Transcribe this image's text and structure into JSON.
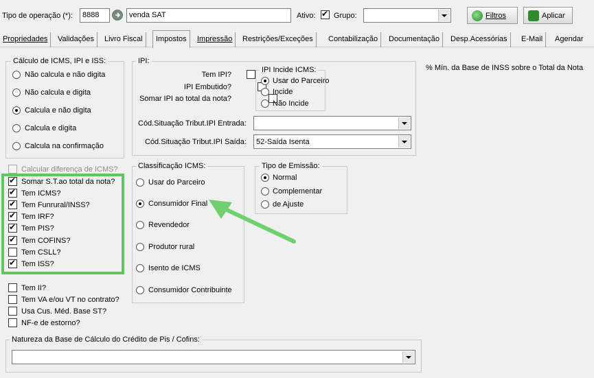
{
  "header": {
    "tipo_label": "Tipo de operação (*):",
    "tipo_code": "8888",
    "tipo_name": "venda SAT",
    "ativo_label": "Ativo:",
    "grupo_label": "Grupo:",
    "grupo_value": "",
    "filtros_label": "Filtros",
    "aplicar_label": "Aplicar"
  },
  "tabs": [
    {
      "label": "Propriedades"
    },
    {
      "label": "Validações"
    },
    {
      "label": "Livro Fiscal"
    },
    {
      "label": "Impostos"
    },
    {
      "label": "Impressão"
    },
    {
      "label": "Restrições/Exceções"
    },
    {
      "label": "Contabilização"
    },
    {
      "label": "Documentação"
    },
    {
      "label": "Desp.Acessórias"
    },
    {
      "label": "E-Mail"
    },
    {
      "label": "Agendar"
    }
  ],
  "calculo": {
    "title": "Cálculo de ICMS, IPI e ISS:",
    "options": [
      "Não calcula e não digita",
      "Não calcula e digita",
      "Calcula e não digita",
      "Calcula e digita",
      "Calcula na confirmação"
    ],
    "selected": "Calcula e não digita"
  },
  "ipi": {
    "title": "IPI:",
    "tem_ipi": "Tem IPI?",
    "ipi_embutido": "IPI Embutido?",
    "somar_ipi": "Somar IPI ao total da nota?",
    "incide_title": "IPI Incide ICMS:",
    "incide_options": [
      "Usar do Parceiro",
      "Incide",
      "Não Incide"
    ],
    "incide_selected": "Usar do Parceiro",
    "cst_entrada_label": "Cód.Situação Tribut.IPI Entrada:",
    "cst_entrada_value": "",
    "cst_saida_label": "Cód.Situação Tribut.IPI Saída:",
    "cst_saida_value": "52-Saída Isenta"
  },
  "inss_label": "% Mín. da Base de INSS sobre o Total da Nota",
  "checks": {
    "calc_dif": "Calcular diferença de ICMS?",
    "somar_st": "Somar S.T.ao total da nota?",
    "tem_icms": "Tem ICMS?",
    "tem_funrural": "Tem Funrural/INSS?",
    "tem_irf": "Tem IRF?",
    "tem_pis": "Tem PIS?",
    "tem_cofins": "Tem COFINS?",
    "tem_csll": "Tem CSLL?",
    "tem_iss": "Tem ISS?",
    "tem_ii": "Tem II?",
    "tem_va": "Tem VA e/ou VT no contrato?",
    "usa_cus": "Usa Cus. Méd. Base ST?",
    "nfe_estorno": "NF-e de estorno?"
  },
  "classificacao": {
    "title": "Classificação ICMS:",
    "options": [
      "Usar do Parceiro",
      "Consumidor Final",
      "Revendedor",
      "Produtor rural",
      "Isento de ICMS",
      "Consumidor Contribuinte"
    ],
    "selected": "Consumidor Final"
  },
  "emissao": {
    "title": "Tipo de Emissão:",
    "options": [
      "Normal",
      "Complementar",
      "de Ajuste"
    ],
    "selected": "Normal"
  },
  "natureza": {
    "title": "Natureza da Base de Cálculo do Crédito de Pis / Cofins:",
    "value": ""
  },
  "colors": {
    "highlight": "#5cc95c",
    "arrow": "#6fd06f"
  }
}
